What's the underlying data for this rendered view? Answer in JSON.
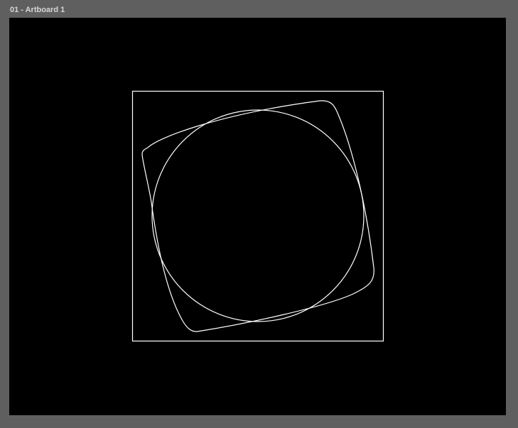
{
  "artboard": {
    "label": "01 - Artboard 1",
    "background_color": "#000000",
    "stroke_color": "#ffffff"
  },
  "window": {
    "background_color": "#5f5f5f"
  },
  "shapes": [
    {
      "kind": "square",
      "name": "bounding-square"
    },
    {
      "kind": "circle",
      "name": "inscribed-circle"
    },
    {
      "kind": "rounded-rotated-square",
      "name": "squircle-shape"
    }
  ]
}
